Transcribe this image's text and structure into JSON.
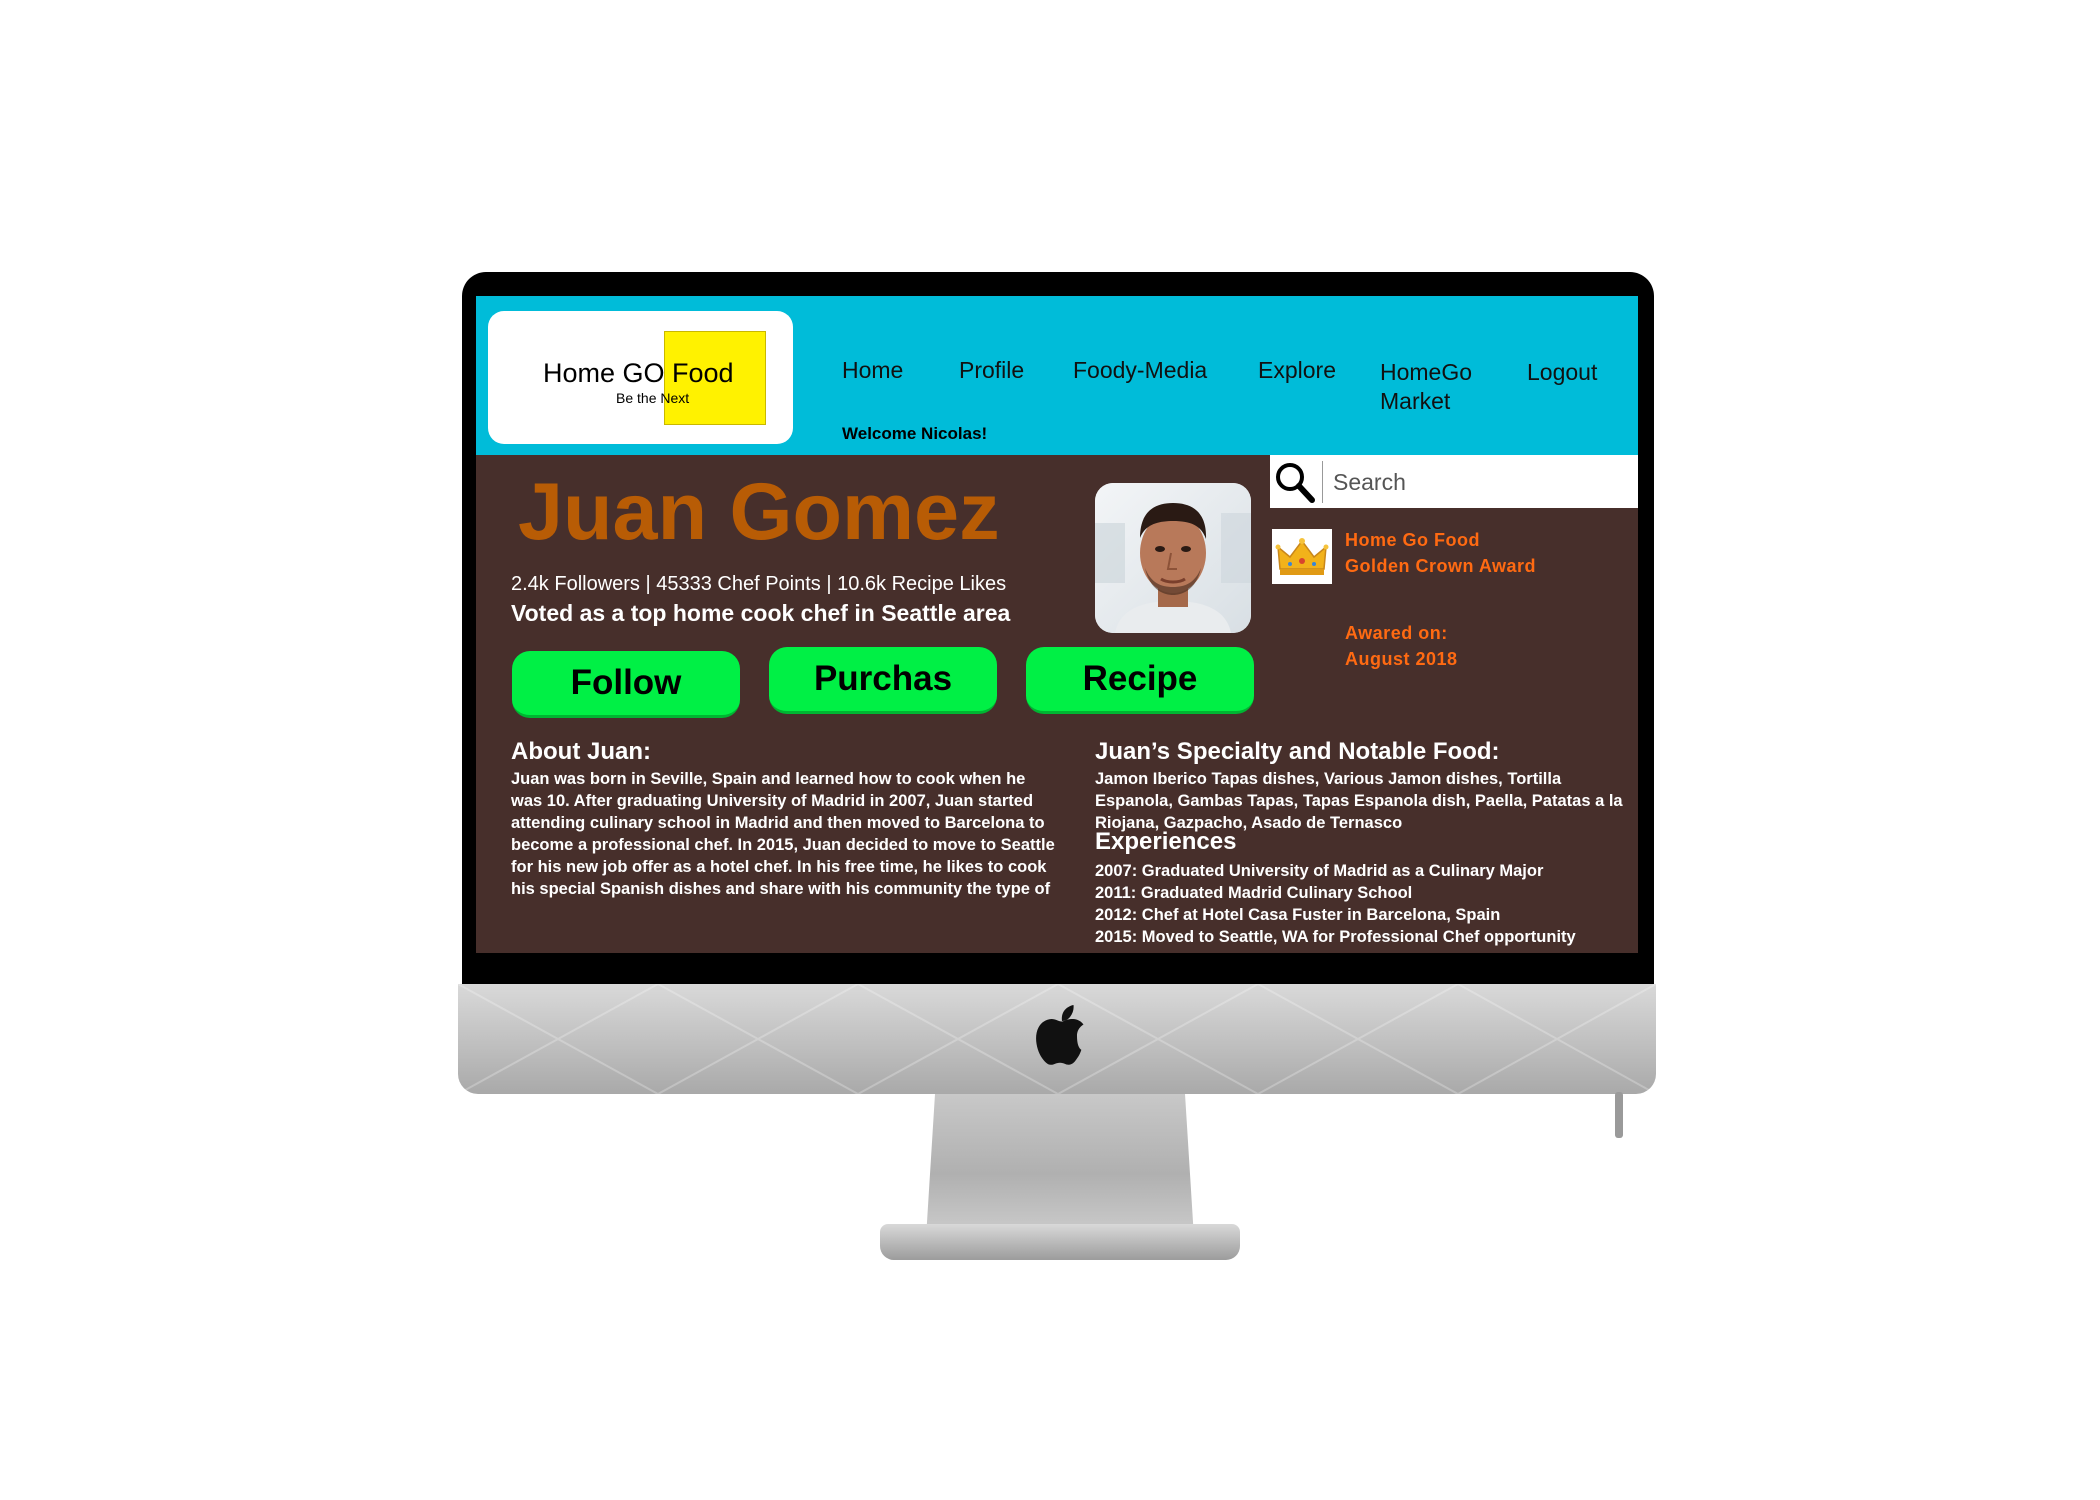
{
  "nav": {
    "logo_title": "Home GO Food",
    "logo_tagline": "Be the Next",
    "items": [
      "Home",
      "Profile",
      "Foody-Media",
      "Explore",
      "HomeGo Market",
      "Logout"
    ],
    "welcome": "Welcome Nicolas!"
  },
  "search": {
    "placeholder": "Search"
  },
  "chef": {
    "name": "Juan Gomez",
    "stats": "2.4k Followers  | 45333 Chef Points | 10.6k Recipe Likes",
    "voted": "Voted as a top home cook chef in Seattle area"
  },
  "buttons": {
    "follow": "Follow",
    "purchase": "Purchas",
    "recipe": "Recipe"
  },
  "award": {
    "title": "Home Go Food Golden Crown Award",
    "date": "Awared on:\nAugust 2018"
  },
  "about": {
    "heading": "About Juan:",
    "text": "Juan was born in Seville, Spain and learned how to cook when he was 10. After graduating University of Madrid in 2007, Juan started attending culinary school in Madrid and then moved to Barcelona to become a professional chef. In 2015, Juan decided to move to Seattle for his new job offer as a hotel chef. In his free time, he likes to cook his special Spanish dishes and share with his community the type of"
  },
  "specialty": {
    "heading": "Juan’s Specialty and Notable Food:",
    "text": "Jamon Iberico Tapas dishes, Various Jamon dishes, Tortilla Espanola, Gambas Tapas, Tapas Espanola dish, Paella, Patatas a la Riojana, Gazpacho, Asado de Ternasco"
  },
  "experiences": {
    "heading": "Experiences",
    "items": [
      "2007: Graduated University of Madrid as a Culinary Major",
      "2011: Graduated Madrid Culinary School",
      "2012: Chef at Hotel Casa Fuster in Barcelona, Spain",
      "2015: Moved to Seattle, WA for Professional Chef opportunity"
    ]
  },
  "colors": {
    "header_bg": "#00bcd9",
    "main_bg": "#472f2b",
    "name_color": "#b85c05",
    "button_green": "#00f045",
    "award_orange": "#ff6a12",
    "logo_yellow": "#fff200"
  },
  "icons": {
    "search": "magnifier-icon",
    "award": "crown-icon",
    "device": "apple-logo-icon"
  }
}
